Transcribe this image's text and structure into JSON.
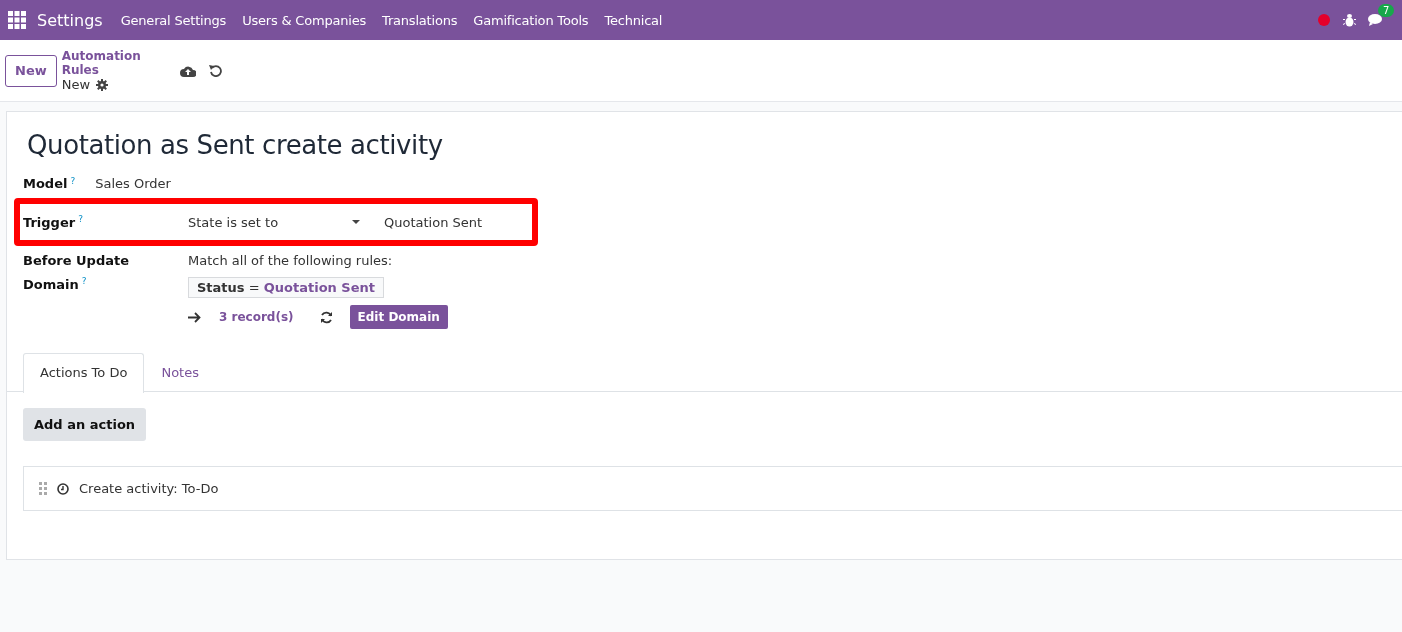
{
  "navbar": {
    "app": "Settings",
    "menu": [
      "General Settings",
      "Users & Companies",
      "Translations",
      "Gamification Tools",
      "Technical"
    ],
    "chat_badge": "7"
  },
  "control_panel": {
    "new_button": "New",
    "breadcrumb": "Automation Rules",
    "record": "New"
  },
  "form": {
    "title": "Quotation as Sent create activity",
    "model": {
      "label": "Model",
      "help": "?",
      "value": "Sales Order"
    },
    "trigger": {
      "label": "Trigger",
      "help": "?",
      "value": "State is set to",
      "state_value": "Quotation Sent",
      "highlighted": true
    },
    "domain": {
      "label_lines": [
        "Before Update",
        "Domain"
      ],
      "help": "?",
      "intro": "Match all of the following rules:",
      "rule_field": "Status",
      "rule_operator": "=",
      "rule_value": "Quotation Sent",
      "records": "3 record(s)",
      "edit_button": "Edit Domain"
    },
    "tabs": [
      {
        "label": "Actions To Do",
        "selected": true
      },
      {
        "label": "Notes",
        "selected": false
      }
    ],
    "add_action": "Add an action",
    "actions": [
      "Create activity: To-Do"
    ]
  }
}
